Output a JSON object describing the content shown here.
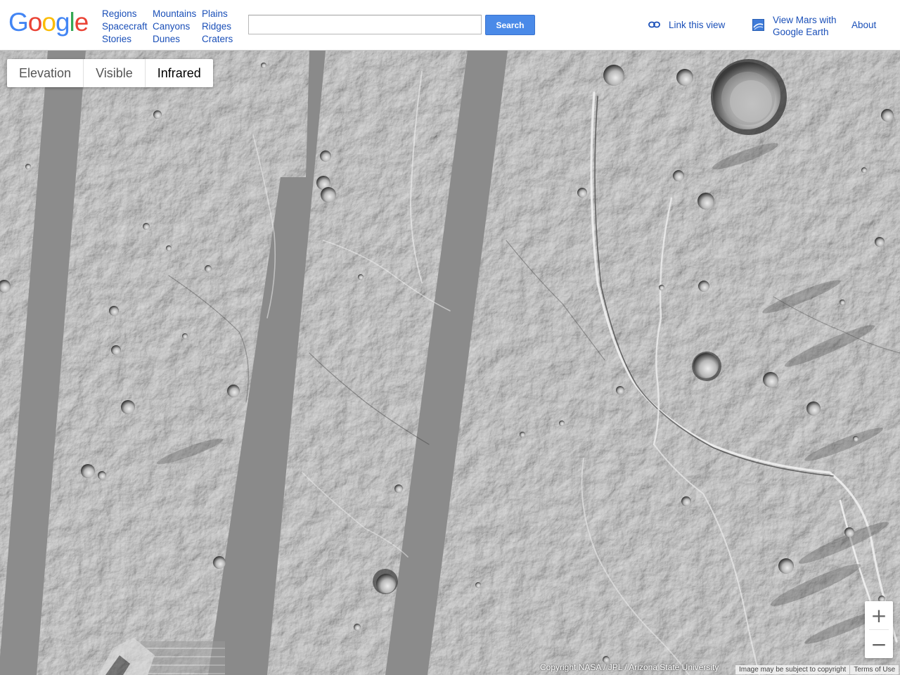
{
  "header": {
    "logo": {
      "letters": [
        "G",
        "o",
        "o",
        "g",
        "l",
        "e"
      ],
      "colors": [
        "#4285f4",
        "#ea4335",
        "#fbbc05",
        "#4285f4",
        "#34a853",
        "#ea4335"
      ]
    },
    "nav_columns": [
      [
        "Regions",
        "Spacecraft",
        "Stories"
      ],
      [
        "Mountains",
        "Canyons",
        "Dunes"
      ],
      [
        "Plains",
        "Ridges",
        "Craters"
      ]
    ],
    "search": {
      "value": "",
      "placeholder": ""
    },
    "search_button_label": "Search",
    "link_view_label": "Link this view",
    "earth_link_lines": [
      "View Mars with",
      "Google Earth"
    ],
    "about_label": "About",
    "link_color": "#1a4fb8",
    "search_button_color": "#4a8ae8"
  },
  "map": {
    "layer_tabs": [
      {
        "label": "Elevation",
        "active": false
      },
      {
        "label": "Visible",
        "active": false
      },
      {
        "label": "Infrared",
        "active": true
      }
    ],
    "zoom_in_label": "+",
    "zoom_out_label": "−",
    "copyright": "Copyright NASA / JPL / Arizona State University",
    "legal": [
      "Image may be subject to copyright",
      "Terms of Use"
    ]
  }
}
